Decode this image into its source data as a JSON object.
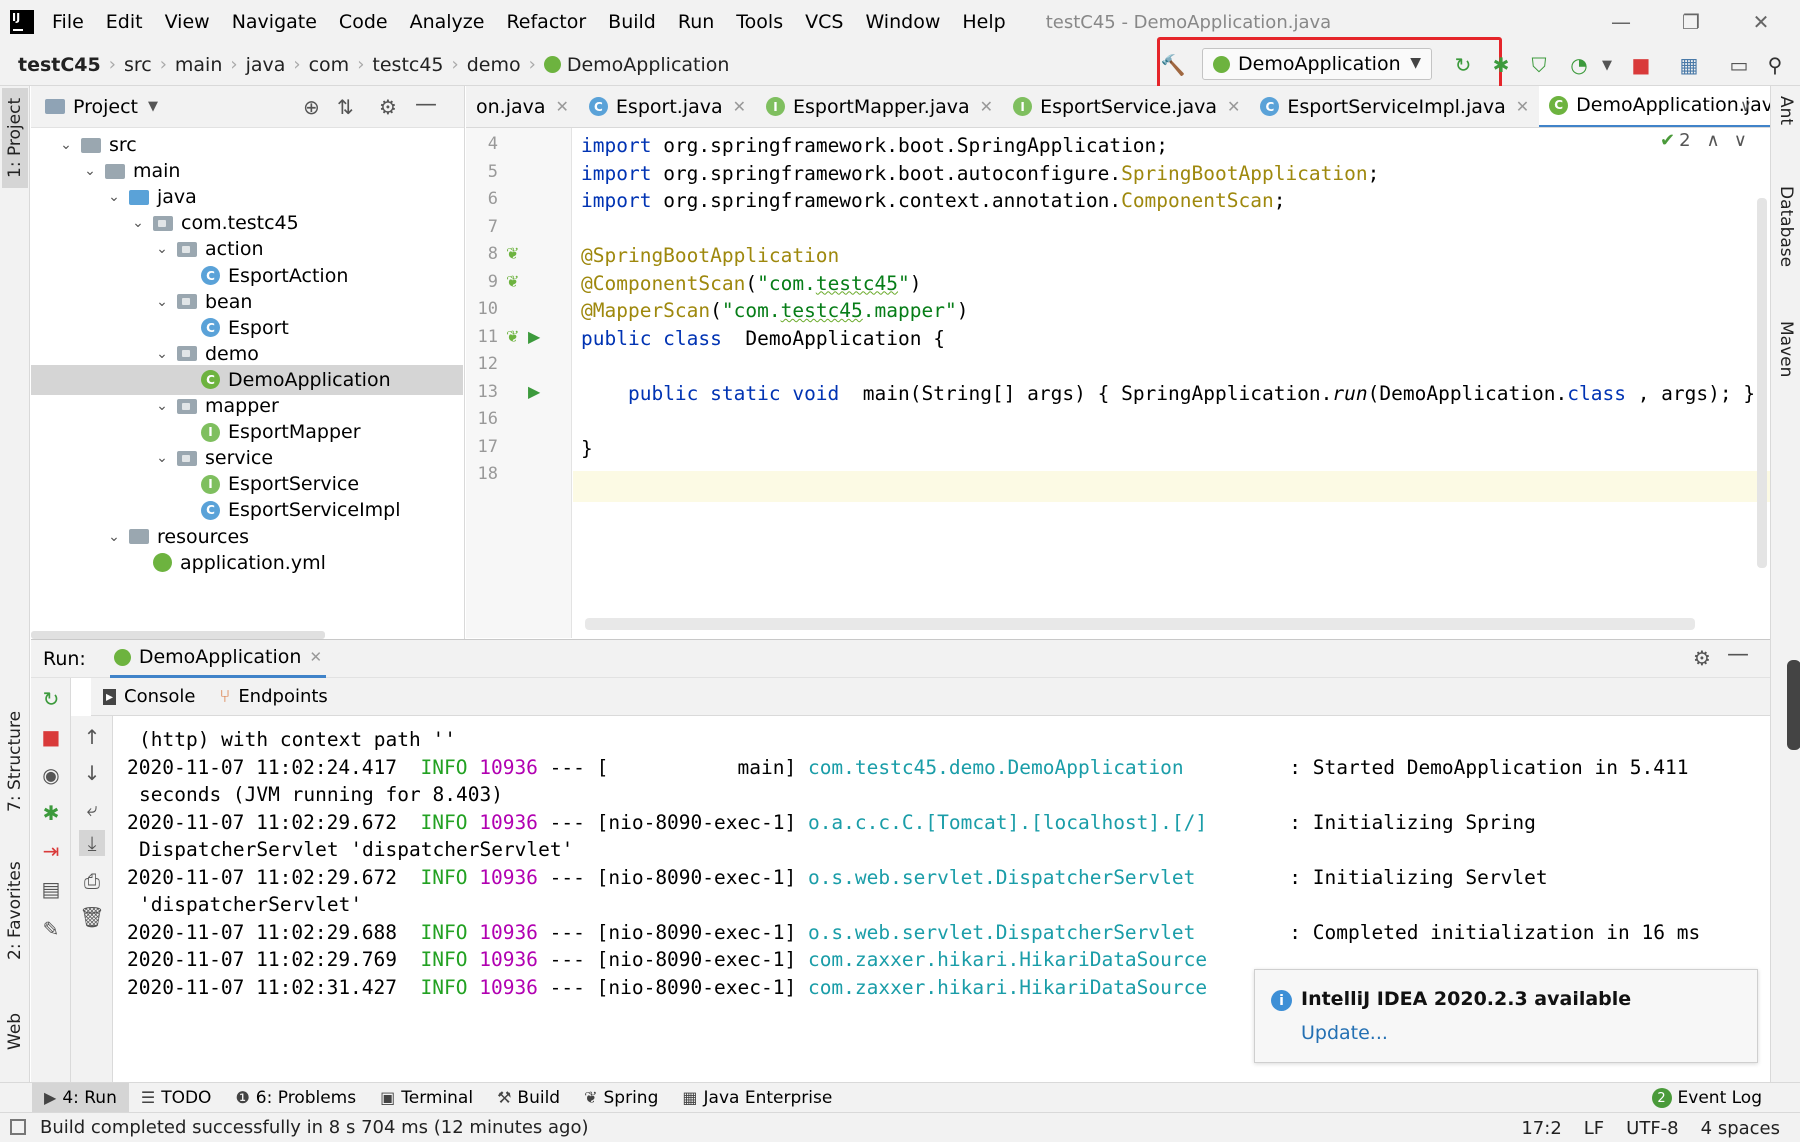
{
  "titlebar": {
    "menu": [
      "File",
      "Edit",
      "View",
      "Navigate",
      "Code",
      "Analyze",
      "Refactor",
      "Build",
      "Run",
      "Tools",
      "VCS",
      "Window",
      "Help"
    ],
    "window_title": "testC45 - DemoApplication.java"
  },
  "navbar": {
    "crumbs": [
      "testC45",
      "src",
      "main",
      "java",
      "com",
      "testc45",
      "demo",
      "DemoApplication"
    ]
  },
  "run_toolbar": {
    "config_label": "DemoApplication"
  },
  "project": {
    "header": "Project",
    "tree": [
      {
        "label": "src",
        "depth": 0,
        "kind": "folder"
      },
      {
        "label": "main",
        "depth": 1,
        "kind": "folder"
      },
      {
        "label": "java",
        "depth": 2,
        "kind": "folder-blue"
      },
      {
        "label": "com.testc45",
        "depth": 3,
        "kind": "pkg"
      },
      {
        "label": "action",
        "depth": 4,
        "kind": "pkg"
      },
      {
        "label": "EsportAction",
        "depth": 5,
        "kind": "class"
      },
      {
        "label": "bean",
        "depth": 4,
        "kind": "pkg"
      },
      {
        "label": "Esport",
        "depth": 5,
        "kind": "class"
      },
      {
        "label": "demo",
        "depth": 4,
        "kind": "pkg"
      },
      {
        "label": "DemoApplication",
        "depth": 5,
        "kind": "spring"
      },
      {
        "label": "mapper",
        "depth": 4,
        "kind": "pkg"
      },
      {
        "label": "EsportMapper",
        "depth": 5,
        "kind": "interface"
      },
      {
        "label": "service",
        "depth": 4,
        "kind": "pkg"
      },
      {
        "label": "EsportService",
        "depth": 5,
        "kind": "interface"
      },
      {
        "label": "EsportServiceImpl",
        "depth": 5,
        "kind": "class"
      },
      {
        "label": "resources",
        "depth": 2,
        "kind": "folder"
      },
      {
        "label": "application.yml",
        "depth": 3,
        "kind": "yml"
      }
    ]
  },
  "editor": {
    "tabs": [
      {
        "label": "on.java",
        "kind": "none"
      },
      {
        "label": "Esport.java",
        "kind": "class"
      },
      {
        "label": "EsportMapper.java",
        "kind": "interface"
      },
      {
        "label": "EsportService.java",
        "kind": "interface"
      },
      {
        "label": "EsportServiceImpl.java",
        "kind": "class"
      },
      {
        "label": "DemoApplication.java",
        "kind": "spring",
        "active": true
      }
    ],
    "inspection_count": "2",
    "lines": [
      {
        "no": "4",
        "parts": [
          [
            "kw",
            "import"
          ],
          [
            "",
            "org.springframework.boot.SpringApplication;"
          ]
        ]
      },
      {
        "no": "5",
        "parts": [
          [
            "kw",
            "import"
          ],
          [
            "",
            "org.springframework.boot.autoconfigure."
          ],
          [
            "ann",
            "SpringBootApplication"
          ],
          [
            "",
            ";"
          ]
        ]
      },
      {
        "no": "6",
        "parts": [
          [
            "kw",
            "import"
          ],
          [
            "",
            "org.springframework.context.annotation."
          ],
          [
            "ann",
            "ComponentScan"
          ],
          [
            "",
            ";"
          ]
        ]
      },
      {
        "no": "7",
        "parts": []
      },
      {
        "no": "8",
        "parts": [
          [
            "ann",
            "@SpringBootApplication"
          ]
        ]
      },
      {
        "no": "9",
        "parts": [
          [
            "ann",
            "@ComponentScan"
          ],
          [
            "",
            "("
          ],
          [
            "str",
            "\"com."
          ],
          [
            "str sq",
            "testc45"
          ],
          [
            "str",
            "\""
          ],
          [
            "",
            ")"
          ]
        ]
      },
      {
        "no": "10",
        "parts": [
          [
            "ann",
            "@MapperScan"
          ],
          [
            "",
            "("
          ],
          [
            "str",
            "\"com."
          ],
          [
            "str sq",
            "testc45"
          ],
          [
            "str",
            ".mapper\""
          ],
          [
            "",
            ")"
          ]
        ]
      },
      {
        "no": "11",
        "parts": [
          [
            "kw",
            "public class"
          ],
          [
            "",
            " DemoApplication {"
          ]
        ]
      },
      {
        "no": "12",
        "parts": []
      },
      {
        "no": "13",
        "parts": [
          [
            "",
            "    "
          ],
          [
            "kw",
            "public static void"
          ],
          [
            "",
            " "
          ],
          [
            "",
            "main(String[] args) { SpringApplication."
          ],
          [
            "it",
            "run"
          ],
          [
            "",
            "(DemoApplication."
          ],
          [
            "kw",
            "class"
          ],
          [
            "",
            ", args); }"
          ]
        ]
      },
      {
        "no": "16",
        "parts": []
      },
      {
        "no": "17",
        "parts": [
          [
            "",
            "}"
          ]
        ]
      },
      {
        "no": "18",
        "parts": []
      }
    ]
  },
  "run_panel": {
    "label": "Run:",
    "config_tab": "DemoApplication",
    "subtabs": [
      "Console",
      "Endpoints"
    ],
    "log": [
      {
        "parts": [
          [
            "",
            "(http) with context path ''"
          ]
        ],
        "indent": true
      },
      {
        "parts": [
          [
            "",
            "2020-11-07 11:02:24.417  "
          ],
          [
            "lvl",
            "INFO"
          ],
          [
            "",
            " "
          ],
          [
            "pid",
            "10936"
          ],
          [
            "",
            " --- [           main] "
          ],
          [
            "logger",
            "com.testc45.demo.DemoApplication        "
          ],
          [
            "",
            " : Started DemoApplication in 5.411"
          ]
        ]
      },
      {
        "parts": [
          [
            "",
            "seconds (JVM running for 8.403)"
          ]
        ],
        "indent": true
      },
      {
        "parts": [
          [
            "",
            "2020-11-07 11:02:29.672  "
          ],
          [
            "lvl",
            "INFO"
          ],
          [
            "",
            " "
          ],
          [
            "pid",
            "10936"
          ],
          [
            "",
            " --- [nio-8090-exec-1] "
          ],
          [
            "logger",
            "o.a.c.c.C.[Tomcat].[localhost].[/]      "
          ],
          [
            "",
            " : Initializing Spring"
          ]
        ]
      },
      {
        "parts": [
          [
            "",
            "DispatcherServlet 'dispatcherServlet'"
          ]
        ],
        "indent": true
      },
      {
        "parts": [
          [
            "",
            "2020-11-07 11:02:29.672  "
          ],
          [
            "lvl",
            "INFO"
          ],
          [
            "",
            " "
          ],
          [
            "pid",
            "10936"
          ],
          [
            "",
            " --- [nio-8090-exec-1] "
          ],
          [
            "logger",
            "o.s.web.servlet.DispatcherServlet       "
          ],
          [
            "",
            " : Initializing Servlet"
          ]
        ]
      },
      {
        "parts": [
          [
            "",
            "'dispatcherServlet'"
          ]
        ],
        "indent": true
      },
      {
        "parts": [
          [
            "",
            "2020-11-07 11:02:29.688  "
          ],
          [
            "lvl",
            "INFO"
          ],
          [
            "",
            " "
          ],
          [
            "pid",
            "10936"
          ],
          [
            "",
            " --- [nio-8090-exec-1] "
          ],
          [
            "logger",
            "o.s.web.servlet.DispatcherServlet       "
          ],
          [
            "",
            " : Completed initialization in 16 ms"
          ]
        ]
      },
      {
        "parts": [
          [
            "",
            "2020-11-07 11:02:29.769  "
          ],
          [
            "lvl",
            "INFO"
          ],
          [
            "",
            " "
          ],
          [
            "pid",
            "10936"
          ],
          [
            "",
            " --- [nio-8090-exec-1] "
          ],
          [
            "logger",
            "com.zaxxer.hikari.HikariDataSource"
          ]
        ]
      },
      {
        "parts": [
          [
            "",
            "2020-11-07 11:02:31.427  "
          ],
          [
            "lvl",
            "INFO"
          ],
          [
            "",
            " "
          ],
          [
            "pid",
            "10936"
          ],
          [
            "",
            " --- [nio-8090-exec-1] "
          ],
          [
            "logger",
            "com.zaxxer.hikari.HikariDataSource"
          ]
        ]
      }
    ]
  },
  "notification": {
    "title": "IntelliJ IDEA 2020.2.3 available",
    "link": "Update..."
  },
  "left_stripe": [
    "1: Project",
    "7: Structure",
    "2: Favorites",
    "Web"
  ],
  "right_stripe": [
    "Ant",
    "Database",
    "Maven"
  ],
  "toolwindows": [
    {
      "label": "4: Run",
      "icon": "▶",
      "active": true
    },
    {
      "label": "TODO",
      "icon": "☰"
    },
    {
      "label": "6: Problems",
      "icon": "❶"
    },
    {
      "label": "Terminal",
      "icon": "▣"
    },
    {
      "label": "Build",
      "icon": "⚒"
    },
    {
      "label": "Spring",
      "icon": "❦"
    },
    {
      "label": "Java Enterprise",
      "icon": "▦"
    }
  ],
  "event_log": {
    "count": "2",
    "label": "Event Log"
  },
  "status": {
    "message": "Build completed successfully in 8 s 704 ms (12 minutes ago)",
    "position": "17:2",
    "line_sep": "LF",
    "encoding": "UTF-8",
    "indent": "4 spaces"
  },
  "colors": {
    "highlight": "#e5252a",
    "keyword": "#0033b3",
    "annotation": "#9e880d",
    "string": "#067d17",
    "log_info": "#22a122",
    "log_pid": "#b100b1",
    "log_logger": "#1a9da8"
  }
}
